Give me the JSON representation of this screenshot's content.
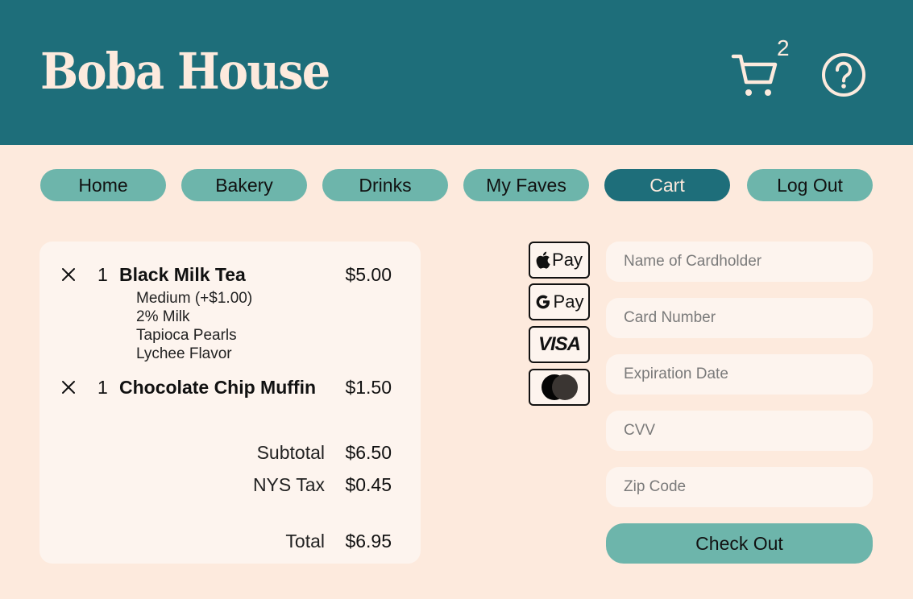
{
  "header": {
    "title": "Boba House",
    "cart_count": "2",
    "icons": [
      "cart-icon",
      "help-icon"
    ]
  },
  "nav": {
    "items": [
      {
        "label": "Home"
      },
      {
        "label": "Bakery"
      },
      {
        "label": "Drinks"
      },
      {
        "label": "My Faves"
      },
      {
        "label": "Cart",
        "active": true
      },
      {
        "label": "Log Out"
      }
    ]
  },
  "order": {
    "items": [
      {
        "qty": "1",
        "name": "Black Milk Tea",
        "price": "$5.00",
        "options": [
          "Medium (+$1.00)",
          "2% Milk",
          "Tapioca Pearls",
          "Lychee Flavor"
        ]
      },
      {
        "qty": "1",
        "name": "Chocolate Chip Muffin",
        "price": "$1.50",
        "options": []
      }
    ],
    "subtotal_label": "Subtotal",
    "subtotal": "$6.50",
    "tax_label": "NYS Tax",
    "tax": "$0.45",
    "total_label": "Total",
    "total": "$6.95"
  },
  "payment": {
    "apple_pay": "Pay",
    "google_pay": "Pay",
    "visa": "VISA",
    "mastercard": "mastercard-icon"
  },
  "form": {
    "name_placeholder": "Name of Cardholder",
    "card_placeholder": "Card Number",
    "expiry_placeholder": "Expiration Date",
    "cvv_placeholder": "CVV",
    "zip_placeholder": "Zip Code",
    "checkout_label": "Check Out"
  },
  "colors": {
    "header_bg": "#1e6e7a",
    "page_bg": "#fdeadd",
    "card_bg": "#fdf4ee",
    "accent": "#6db5ab"
  }
}
